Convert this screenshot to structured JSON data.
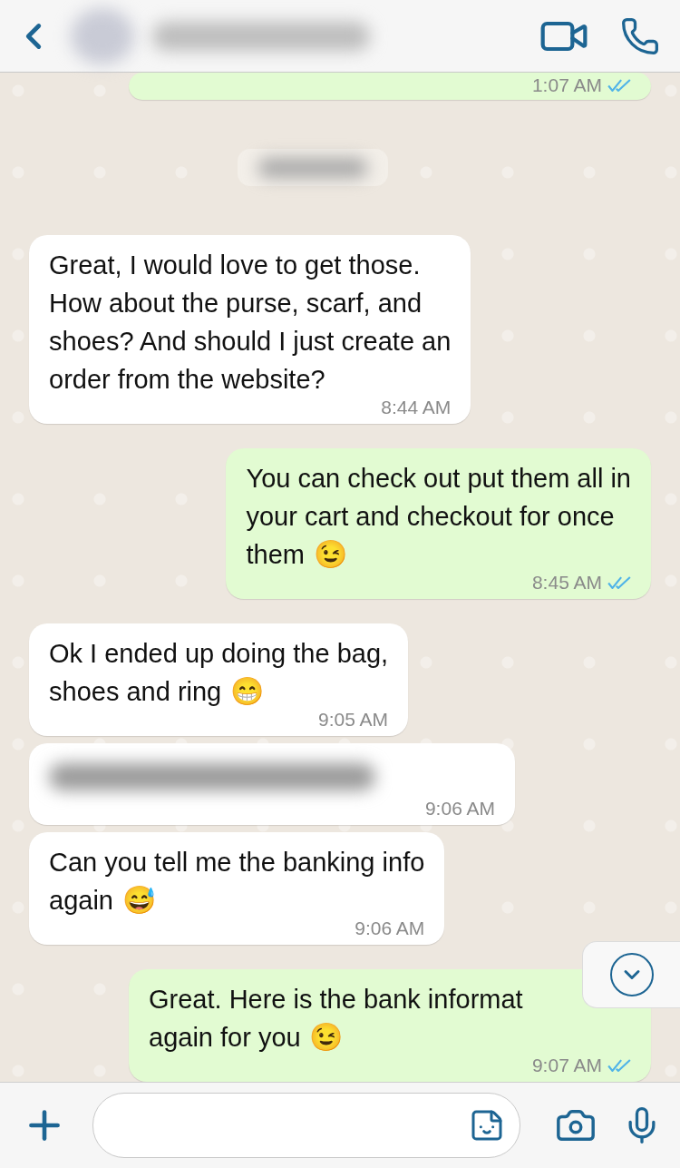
{
  "header": {
    "contact_blurred": true
  },
  "messages": [
    {
      "kind": "out",
      "time": "1:07 AM",
      "read": true
    },
    {
      "kind": "date",
      "blurred": true
    },
    {
      "kind": "in",
      "lines": [
        "Great, I would love to get those.",
        "How about the purse, scarf, and",
        "shoes? And should I just create an",
        "order from the website?"
      ],
      "time": "8:44 AM"
    },
    {
      "kind": "out",
      "lines": [
        "You can check out put them all in",
        "your cart and checkout for once",
        "them"
      ],
      "emoji": "😉",
      "time": "8:45 AM",
      "read": true
    },
    {
      "kind": "in",
      "lines": [
        "Ok I ended up doing the bag,",
        "shoes and ring"
      ],
      "emoji": "😁",
      "time": "9:05 AM"
    },
    {
      "kind": "in",
      "blurred": true,
      "time": "9:06 AM"
    },
    {
      "kind": "in",
      "lines": [
        "Can you tell me the banking info",
        "again"
      ],
      "emoji": "😅",
      "time": "9:06 AM"
    },
    {
      "kind": "out",
      "lines": [
        "Great. Here is the bank informat",
        "again for you"
      ],
      "emoji": "😉",
      "time": "9:07 AM",
      "read": true
    }
  ],
  "composer": {
    "value_empty": true
  }
}
